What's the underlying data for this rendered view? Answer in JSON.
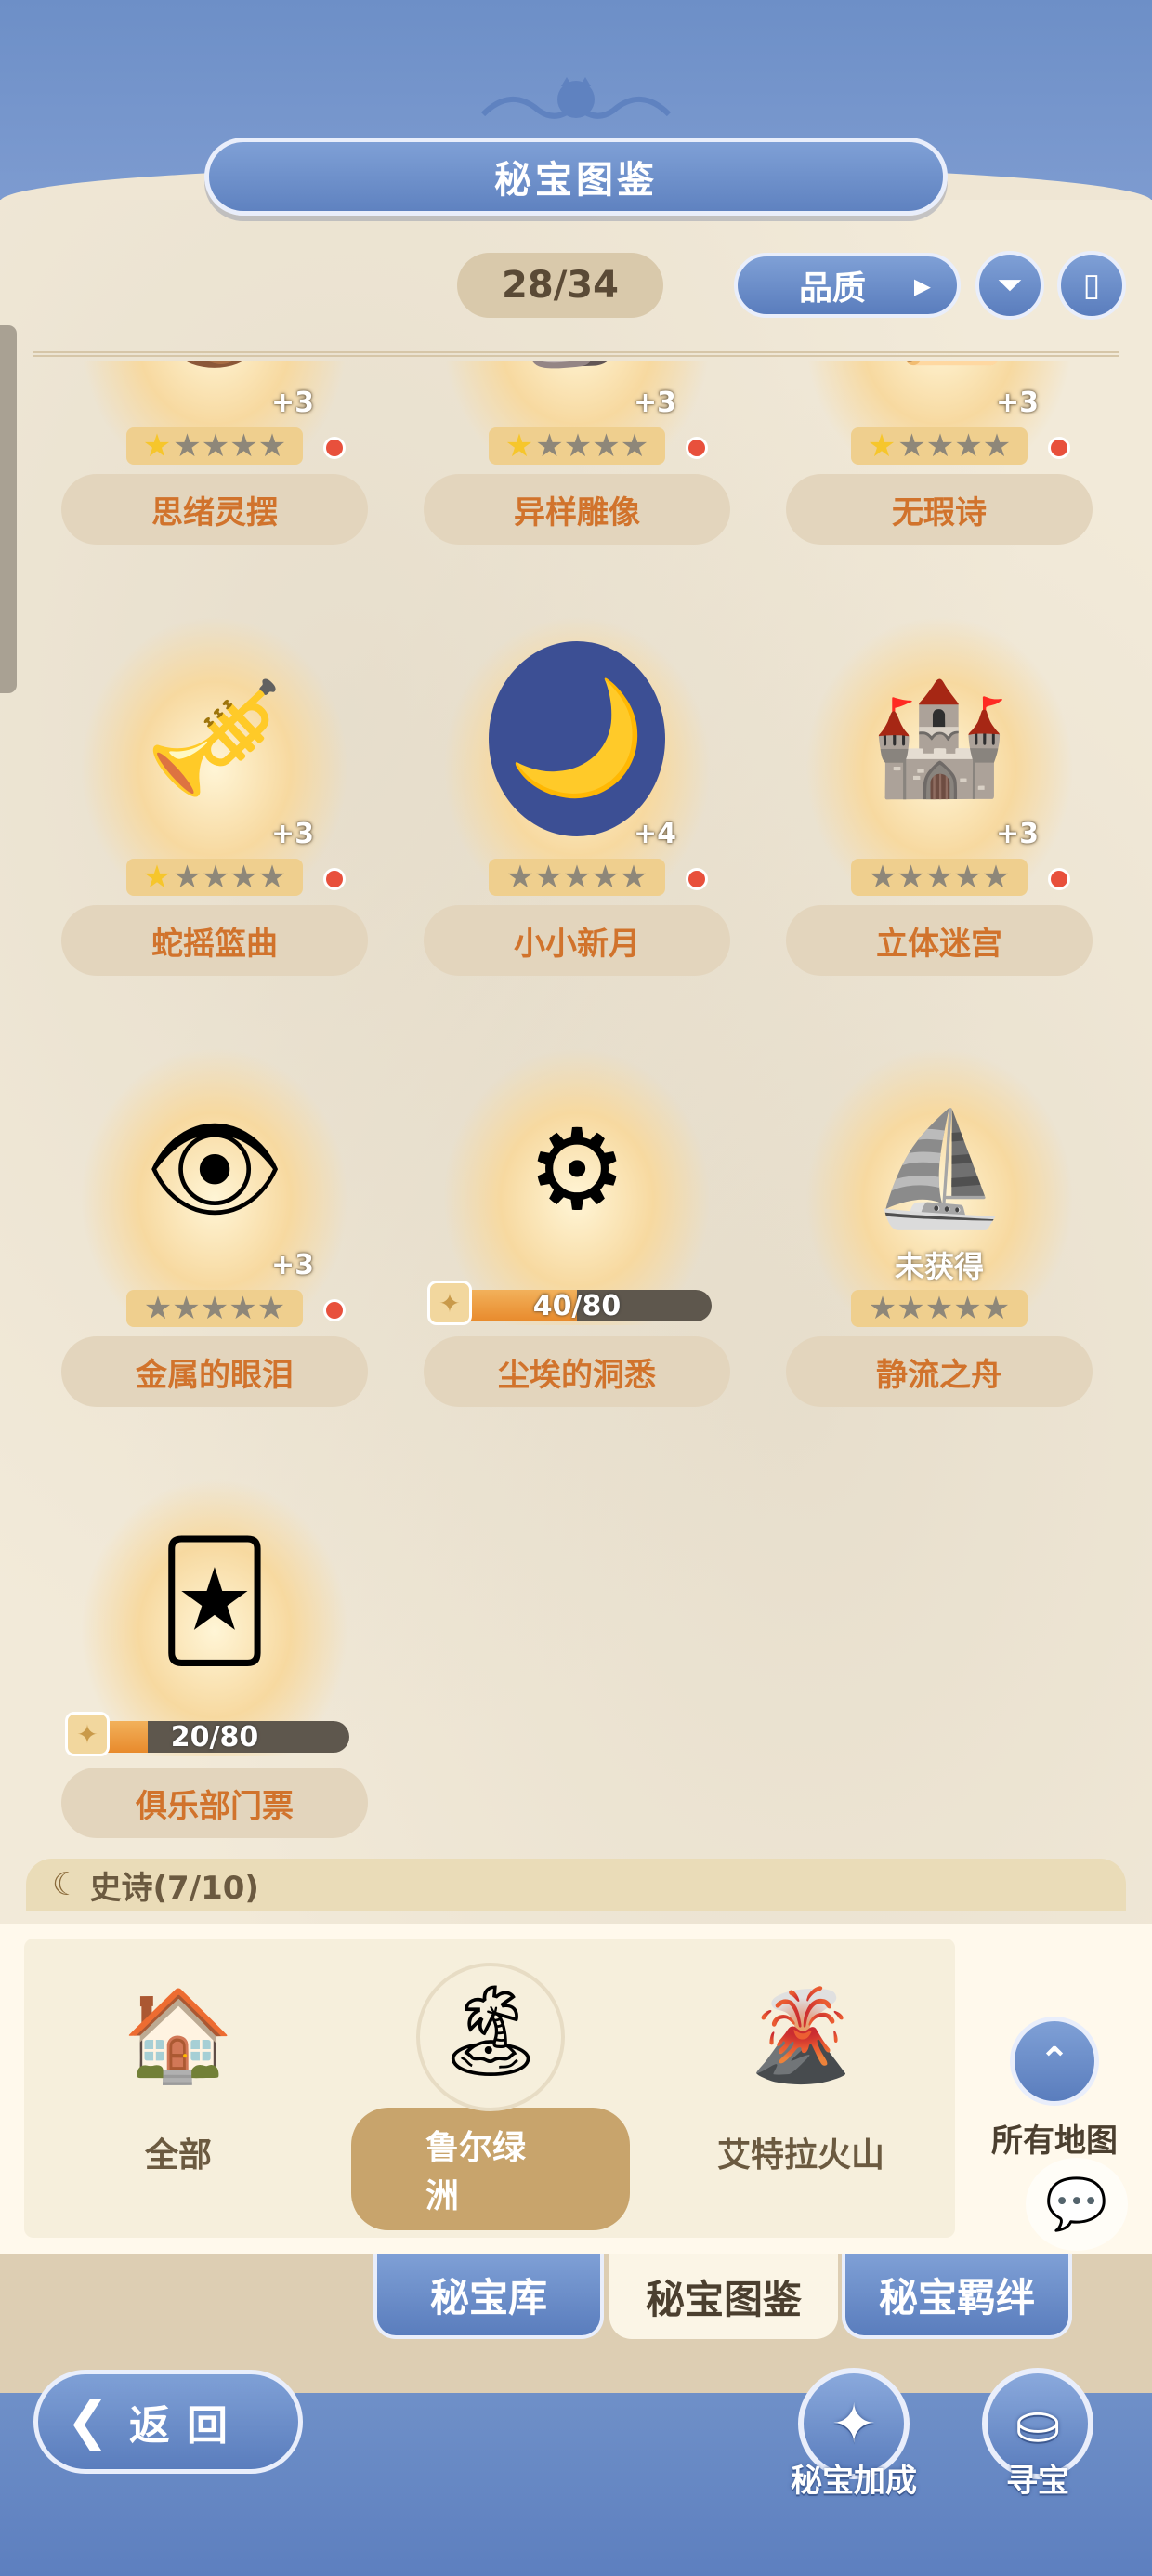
{
  "header": {
    "title": "秘宝图鉴",
    "counter": "28/34",
    "sort_label": "品质",
    "filter_icon": "filter-icon",
    "book_icon": "book-icon"
  },
  "items": [
    {
      "name": "思绪灵摆",
      "plus": "+3",
      "stars": 1,
      "status": "owned",
      "red_dot": true
    },
    {
      "name": "异样雕像",
      "plus": "+3",
      "stars": 1,
      "status": "owned",
      "red_dot": true
    },
    {
      "name": "无瑕诗",
      "plus": "+3",
      "stars": 1,
      "status": "owned",
      "red_dot": true
    },
    {
      "name": "蛇摇篮曲",
      "plus": "+3",
      "stars": 1,
      "status": "owned",
      "red_dot": true
    },
    {
      "name": "小小新月",
      "plus": "+4",
      "stars": 0,
      "status": "owned",
      "red_dot": true
    },
    {
      "name": "立体迷宫",
      "plus": "+3",
      "stars": 0,
      "status": "owned",
      "red_dot": true
    },
    {
      "name": "金属的眼泪",
      "plus": "+3",
      "stars": 0,
      "status": "owned",
      "red_dot": true
    },
    {
      "name": "尘埃的洞悉",
      "status": "progress",
      "progress_text": "40/80",
      "progress": 0.5
    },
    {
      "name": "静流之舟",
      "status": "locked",
      "lock_text": "未获得"
    },
    {
      "name": "俱乐部门票",
      "status": "progress",
      "progress_text": "20/80",
      "progress": 0.25
    }
  ],
  "section": {
    "label": "史诗(7/10)"
  },
  "regions": [
    {
      "label": "全部",
      "selected": false
    },
    {
      "label": "鲁尔绿洲",
      "selected": true
    },
    {
      "label": "艾特拉火山",
      "selected": false
    }
  ],
  "all_maps_label": "所有地图",
  "tabs": [
    {
      "label": "秘宝库",
      "active": false
    },
    {
      "label": "秘宝图鉴",
      "active": true
    },
    {
      "label": "秘宝羁绊",
      "active": false
    }
  ],
  "back_label": "返回",
  "actions": [
    {
      "label": "秘宝加成",
      "icon": "sparkle-sword-icon"
    },
    {
      "label": "寻宝",
      "icon": "treasure-chest-icon"
    }
  ],
  "colors": {
    "accent_blue": "#5f82c0",
    "name_orange": "#d1732c",
    "card_bg": "#e3d5bd",
    "red_dot": "#e8503c"
  }
}
